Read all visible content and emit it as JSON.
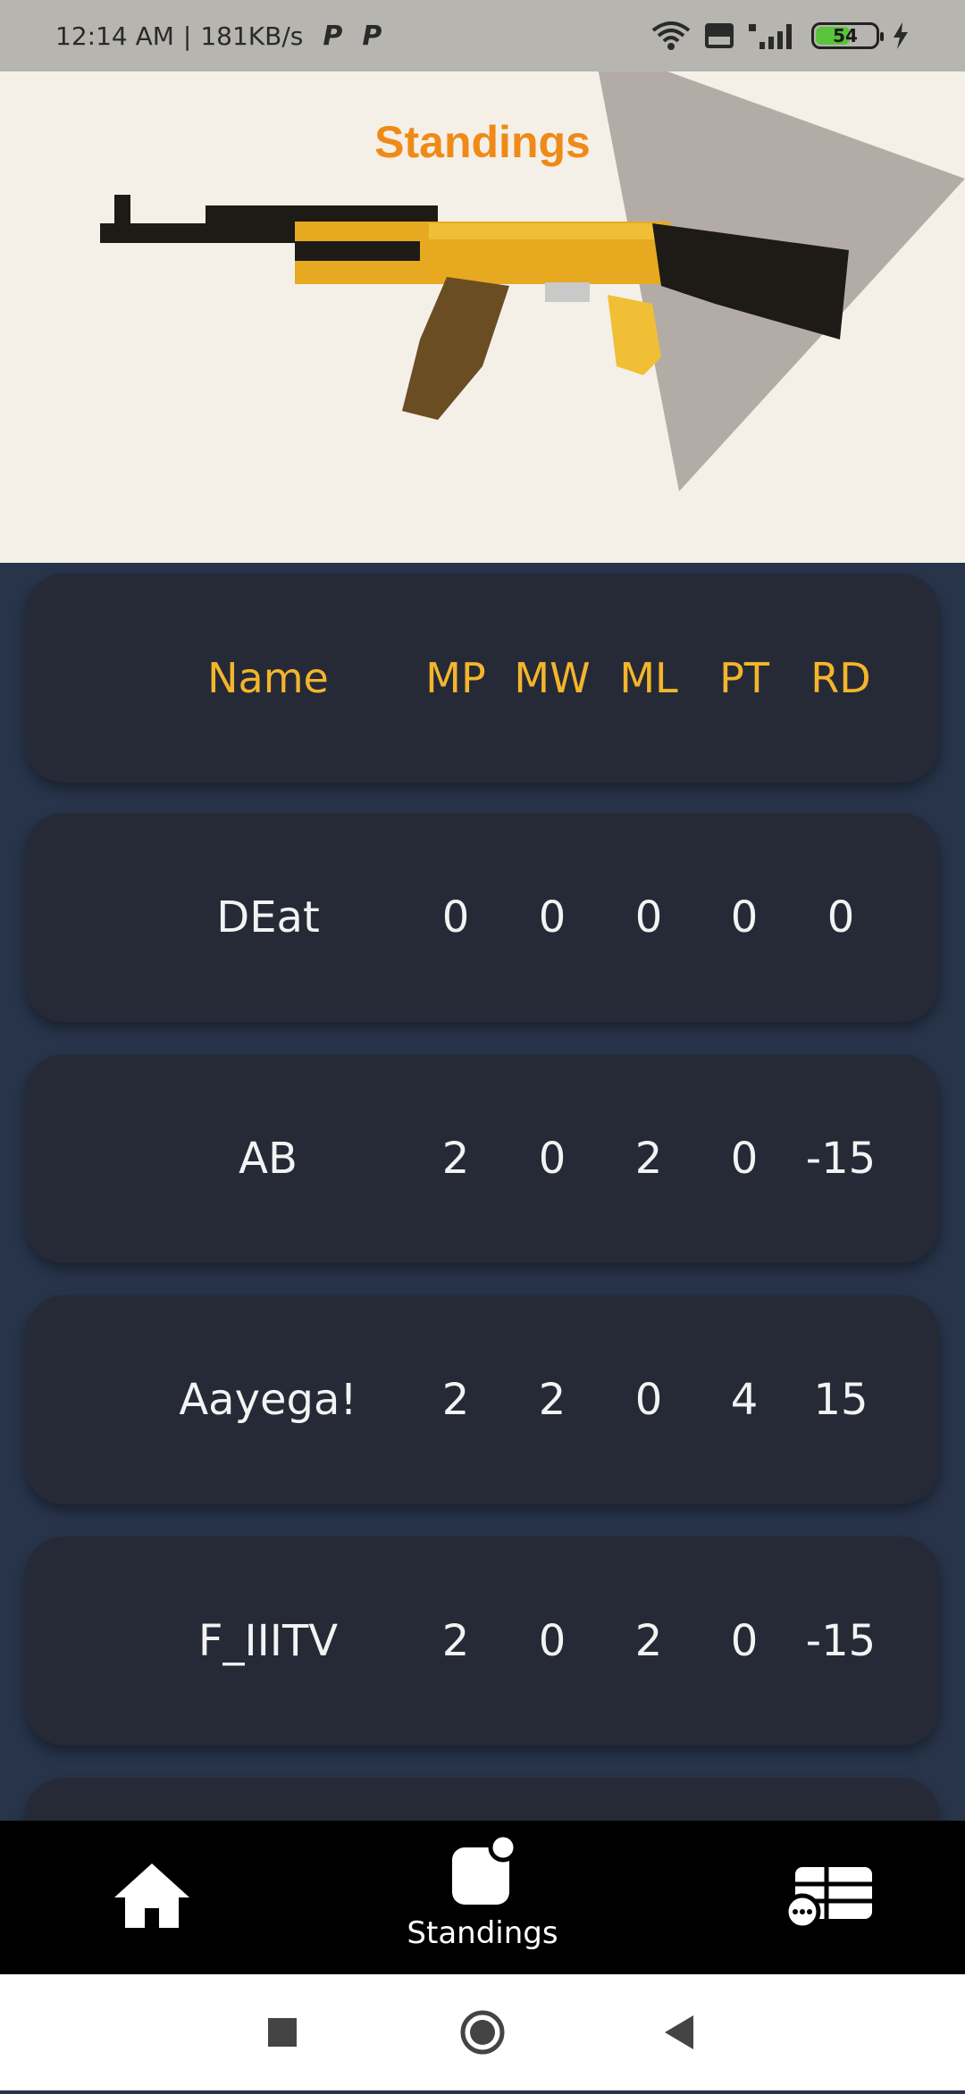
{
  "status_bar": {
    "time": "12:14 AM",
    "net_speed": "181KB/s",
    "notif_icons": [
      "P",
      "P"
    ],
    "battery_level": "54"
  },
  "header": {
    "title": "Standings"
  },
  "table": {
    "columns": [
      "Name",
      "MP",
      "MW",
      "ML",
      "PT",
      "RD"
    ],
    "rows": [
      {
        "name": "DEat",
        "mp": "0",
        "mw": "0",
        "ml": "0",
        "pt": "0",
        "rd": "0"
      },
      {
        "name": "AB",
        "mp": "2",
        "mw": "0",
        "ml": "2",
        "pt": "0",
        "rd": "-15"
      },
      {
        "name": "Aayega!",
        "mp": "2",
        "mw": "2",
        "ml": "0",
        "pt": "4",
        "rd": "15"
      },
      {
        "name": "F_IIITV",
        "mp": "2",
        "mw": "0",
        "ml": "2",
        "pt": "0",
        "rd": "-15"
      }
    ]
  },
  "bottom_nav": {
    "items": [
      {
        "icon": "home-icon",
        "label": ""
      },
      {
        "icon": "standings-icon",
        "label": "Standings"
      },
      {
        "icon": "table-chat-icon",
        "label": ""
      }
    ]
  },
  "colors": {
    "accent_title": "#ef8a17",
    "header_text": "#f4b52c",
    "card_bg": "#252a36",
    "page_bg": "#27344a"
  }
}
